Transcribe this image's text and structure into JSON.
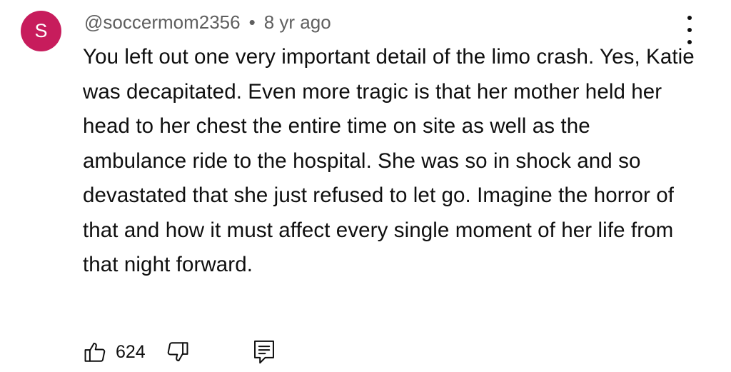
{
  "comment": {
    "avatar_letter": "S",
    "avatar_color": "#c71c5c",
    "username": "@soccermom2356",
    "separator": "•",
    "time_ago": "8 yr ago",
    "body": "You left out one very important detail of the limo crash. Yes, Katie was decapitated. Even more tragic is that her mother held her head to her chest the entire time on site as well as the ambulance ride to the hospital. She was so in shock and so devastated that she just refused to let go. Imagine the horror of that and how it must affect every single moment of her life from that night forward.",
    "like_count": "624"
  },
  "icons": {
    "more": "more-vertical-icon",
    "like": "thumbs-up-icon",
    "dislike": "thumbs-down-icon",
    "reply": "reply-comment-icon"
  }
}
